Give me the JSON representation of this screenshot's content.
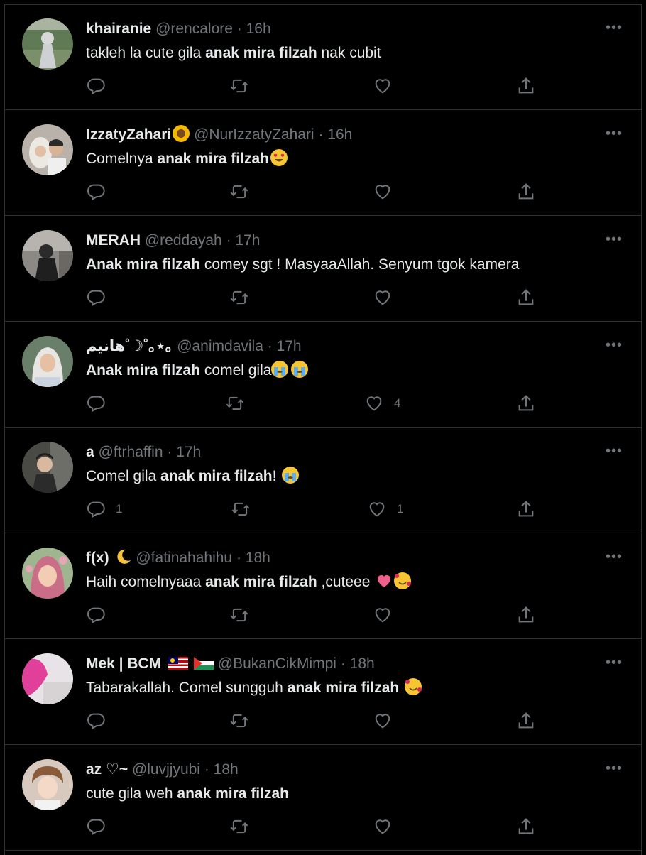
{
  "colors": {
    "background": "#000000",
    "divider": "#2f3336",
    "text_primary": "#e7e9ea",
    "text_secondary": "#71767b"
  },
  "tweets": [
    {
      "name": "khairanie",
      "handle": "@rencalore",
      "time": "16h",
      "text_pre": "takleh la cute gila ",
      "text_bold": "anak mira filzah",
      "text_post": " nak cubit",
      "reply_count": "",
      "like_count": "",
      "avatar_color": "#5f7a55"
    },
    {
      "name": "IzzatyZahari",
      "handle": "@NurIzzatyZahari",
      "time": "16h",
      "text_pre": "Comelnya ",
      "text_bold": "anak mira filzah",
      "text_post": "",
      "reply_count": "",
      "like_count": "",
      "avatar_color": "#b9b2ab"
    },
    {
      "name": "MERAH",
      "handle": "@reddayah",
      "time": "17h",
      "text_pre": "",
      "text_bold": "Anak mira filzah",
      "text_post": " comey sgt ! MasyaaAllah. Senyum tgok kamera",
      "reply_count": "",
      "like_count": "",
      "avatar_color": "#3d3a3a"
    },
    {
      "name": "هانيم˚☽˚｡⋆｡",
      "handle": "@animdavila",
      "time": "17h",
      "text_pre": "",
      "text_bold": "Anak mira filzah",
      "text_post": " comel gila",
      "reply_count": "",
      "like_count": "4",
      "avatar_color": "#6a7f6a"
    },
    {
      "name": "a",
      "handle": "@ftrhaffin",
      "time": "17h",
      "text_pre": "Comel gila ",
      "text_bold": "anak mira filzah",
      "text_post": "!",
      "reply_count": "1",
      "like_count": "1",
      "avatar_color": "#4a4a45"
    },
    {
      "name": "f(x)",
      "handle": "@fatinahahihu",
      "time": "18h",
      "text_pre": "Haih comelnyaaa ",
      "text_bold": "anak mira filzah",
      "text_post": " ,cuteee",
      "reply_count": "",
      "like_count": "",
      "avatar_color": "#c98a8f"
    },
    {
      "name": "Mek | BCM",
      "handle": "@BukanCikMimpi",
      "time": "18h",
      "text_pre": "Tabarakallah. Comel sungguh ",
      "text_bold": "anak mira filzah",
      "text_post": "",
      "reply_count": "",
      "like_count": "",
      "avatar_color": "#e8d7e4"
    },
    {
      "name": "az ♡~",
      "handle": "@luvjjyubi",
      "time": "18h",
      "text_pre": "cute gila weh ",
      "text_bold": "anak mira filzah",
      "text_post": "",
      "reply_count": "",
      "like_count": "",
      "avatar_color": "#d8c9bf"
    }
  ]
}
